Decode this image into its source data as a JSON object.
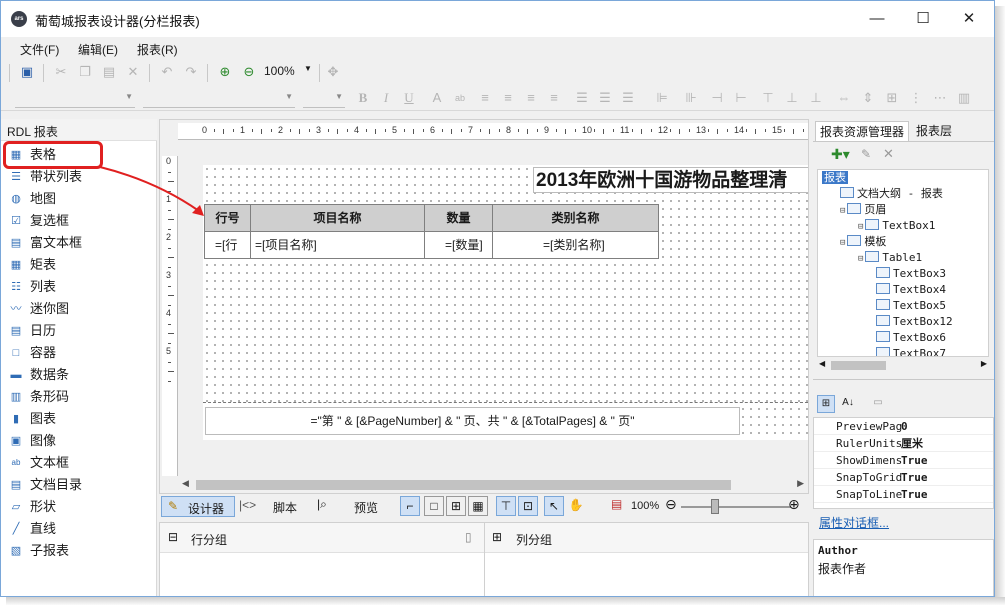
{
  "window": {
    "title": "葡萄城报表设计器(分栏报表)",
    "logo_text": "ars",
    "minimize_glyph": "—",
    "maximize_glyph": "☐",
    "close_glyph": "✕"
  },
  "menu": {
    "file": "文件(F)",
    "edit": "编辑(E)",
    "report": "报表(R)"
  },
  "toolbar": {
    "zoom": "100%"
  },
  "palette": {
    "header": "RDL 报表",
    "items": [
      {
        "label": "表格",
        "icon": "table-icon"
      },
      {
        "label": "带状列表",
        "icon": "banded-list-icon"
      },
      {
        "label": "地图",
        "icon": "globe-icon"
      },
      {
        "label": "复选框",
        "icon": "checkbox-icon"
      },
      {
        "label": "富文本框",
        "icon": "rich-textbox-icon"
      },
      {
        "label": "矩表",
        "icon": "matrix-icon"
      },
      {
        "label": "列表",
        "icon": "list-icon"
      },
      {
        "label": "迷你图",
        "icon": "sparkline-icon"
      },
      {
        "label": "日历",
        "icon": "calendar-icon"
      },
      {
        "label": "容器",
        "icon": "container-icon"
      },
      {
        "label": "数据条",
        "icon": "databar-icon"
      },
      {
        "label": "条形码",
        "icon": "barcode-icon"
      },
      {
        "label": "图表",
        "icon": "chart-icon"
      },
      {
        "label": "图像",
        "icon": "image-icon"
      },
      {
        "label": "文本框",
        "icon": "textbox-icon"
      },
      {
        "label": "文档目录",
        "icon": "toc-icon"
      },
      {
        "label": "形状",
        "icon": "shape-icon"
      },
      {
        "label": "直线",
        "icon": "line-icon"
      },
      {
        "label": "子报表",
        "icon": "subreport-icon"
      }
    ]
  },
  "designer": {
    "title": "2013年欧洲十国游物品整理清",
    "headers": [
      "行号",
      "项目名称",
      "数量",
      "类别名称"
    ],
    "row": [
      "=[行",
      "=[项目名称]",
      "=[数量]",
      "=[类别名称]"
    ],
    "footer": "=\"第 \" & [&PageNumber] & \" 页、共 \" & [&TotalPages] & \" 页\"",
    "ruler_h": [
      "0",
      "1",
      "2",
      "3",
      "4",
      "5",
      "6",
      "7",
      "8",
      "9",
      "10",
      "11",
      "12",
      "13",
      "14",
      "15"
    ],
    "ruler_v": [
      "0",
      "1",
      "2",
      "3",
      "4",
      "5"
    ]
  },
  "modes": {
    "design": "设计器",
    "script": "脚本",
    "preview": "预览",
    "zoom": "100%"
  },
  "groups": {
    "row": "行分组",
    "column": "列分组"
  },
  "right": {
    "tabs": [
      "报表资源管理器",
      "报表层"
    ],
    "tree": [
      {
        "label": "报表",
        "depth": 0,
        "selected": true
      },
      {
        "label": "文档大纲 - 报表",
        "depth": 1
      },
      {
        "label": "页眉",
        "depth": 1
      },
      {
        "label": "TextBox1",
        "depth": 2
      },
      {
        "label": "模板",
        "depth": 1
      },
      {
        "label": "Table1",
        "depth": 2
      },
      {
        "label": "TextBox3",
        "depth": 3
      },
      {
        "label": "TextBox4",
        "depth": 3
      },
      {
        "label": "TextBox5",
        "depth": 3
      },
      {
        "label": "TextBox12",
        "depth": 3
      },
      {
        "label": "TextBox6",
        "depth": 3
      },
      {
        "label": "TextBox7",
        "depth": 3
      }
    ],
    "props": [
      {
        "name": "PreviewPag",
        "value": "0"
      },
      {
        "name": "RulerUnits",
        "value": "厘米"
      },
      {
        "name": "ShowDimens",
        "value": "True"
      },
      {
        "name": "SnapToGrid",
        "value": "True"
      },
      {
        "name": "SnapToLine",
        "value": "True"
      }
    ],
    "props_link": "属性对话框...",
    "desc_title": "Author",
    "desc_text": "报表作者"
  }
}
